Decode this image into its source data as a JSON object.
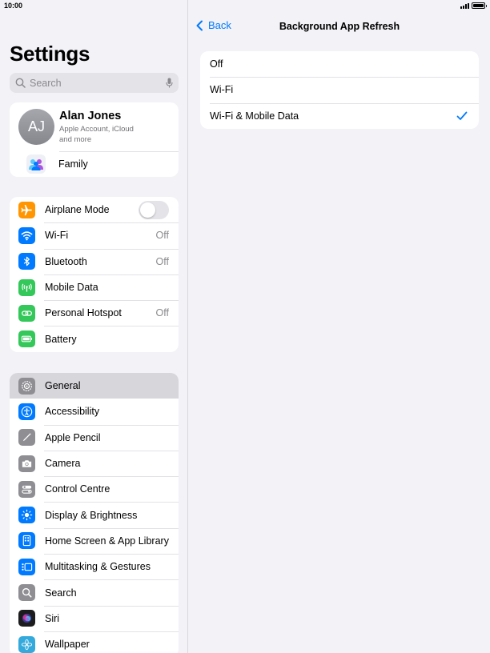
{
  "status_bar": {
    "time": "10:00"
  },
  "sidebar": {
    "title": "Settings",
    "search": {
      "placeholder": "Search"
    },
    "account": {
      "initials": "AJ",
      "name": "Alan Jones",
      "subtitle": "Apple Account, iCloud and more",
      "family_label": "Family"
    },
    "connectivity": [
      {
        "label": "Airplane Mode",
        "icon": "airplane-icon",
        "color": "#ff9500",
        "toggle": false
      },
      {
        "label": "Wi-Fi",
        "icon": "wifi-icon",
        "color": "#007aff",
        "value": "Off"
      },
      {
        "label": "Bluetooth",
        "icon": "bluetooth-icon",
        "color": "#007aff",
        "value": "Off"
      },
      {
        "label": "Mobile Data",
        "icon": "antenna-icon",
        "color": "#34c759"
      },
      {
        "label": "Personal Hotspot",
        "icon": "hotspot-icon",
        "color": "#34c759",
        "value": "Off"
      },
      {
        "label": "Battery",
        "icon": "battery-icon",
        "color": "#34c759"
      }
    ],
    "system": [
      {
        "label": "General",
        "icon": "gear-icon",
        "color": "#8e8e93",
        "selected": true
      },
      {
        "label": "Accessibility",
        "icon": "accessibility-icon",
        "color": "#007aff"
      },
      {
        "label": "Apple Pencil",
        "icon": "pencil-icon",
        "color": "#8e8e93"
      },
      {
        "label": "Camera",
        "icon": "camera-icon",
        "color": "#8e8e93"
      },
      {
        "label": "Control Centre",
        "icon": "switches-icon",
        "color": "#8e8e93"
      },
      {
        "label": "Display & Brightness",
        "icon": "sun-icon",
        "color": "#007aff"
      },
      {
        "label": "Home Screen & App Library",
        "icon": "home-screen-icon",
        "color": "#007aff"
      },
      {
        "label": "Multitasking & Gestures",
        "icon": "multitasking-icon",
        "color": "#007aff"
      },
      {
        "label": "Search",
        "icon": "search-icon",
        "color": "#8e8e93"
      },
      {
        "label": "Siri",
        "icon": "siri-icon",
        "color": "#1c1c1e"
      },
      {
        "label": "Wallpaper",
        "icon": "flower-icon",
        "color": "#34aadc"
      }
    ]
  },
  "detail": {
    "back_label": "Back",
    "title": "Background App Refresh",
    "options": [
      {
        "label": "Off",
        "checked": false
      },
      {
        "label": "Wi-Fi",
        "checked": false
      },
      {
        "label": "Wi-Fi & Mobile Data",
        "checked": true
      }
    ]
  },
  "colors": {
    "accent": "#007aff",
    "background": "#f2f2f7",
    "selected_row": "#d6d6db"
  }
}
